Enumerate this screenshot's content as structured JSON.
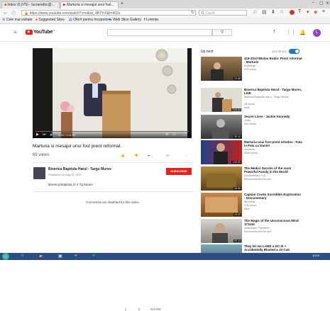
{
  "browser": {
    "tabs": [
      {
        "label": "Inbox (6,075) - lucraredoc@..."
      },
      {
        "label": "Marturia si mesajul unui fost..."
      }
    ],
    "new_tab": "+",
    "url": "https://www.youtube.com/watch?v=ulkss_4B7Yr0&t=402s",
    "search_placeholder": "Cautã",
    "bookmarks": [
      "Cele mai vizitate",
      "Suggested Sites",
      "Oferit pentru Inceputiori",
      "Web Slice Gallery",
      "Lorenta"
    ]
  },
  "youtube": {
    "logo": "YouTube",
    "logo_suffix": "RO",
    "avatar_letter": "L"
  },
  "video": {
    "time": "0:23 / 1:11:52",
    "title": "Marturia si mesajul unui fost preot reformat.",
    "views": "69 views",
    "likes": "1",
    "dislikes": "0",
    "share": "SHARE"
  },
  "channel": {
    "name": "Biserica Baptista Harul - Targu Mures",
    "published": "Published on Aug 22, 2017",
    "subscribe": "SUBSCRIBE",
    "description": "Biserica Baptista nr 2 Tg Mures"
  },
  "comments_text": "Comments are disabled for this video.",
  "sidebar": {
    "up_next": "Up next",
    "autoplay": "AUTOPLAY",
    "items": [
      {
        "title": "419-2013 Mislos Bodis- Preot reformat - Marturie",
        "channel": "bodisinge",
        "views": "276 views",
        "duration": "24:48"
      },
      {
        "title": "Biserica Baptista Harul - Targu Mures, LIVE",
        "channel": "Biserica Baptista Harul - Targu Mures",
        "views": "48 views",
        "extra": "New",
        "duration": "2:04:34"
      },
      {
        "title": "Secret Lives - Jackie Kennedy",
        "channel": "Jolan",
        "views": "615 views",
        "duration": "50:10"
      },
      {
        "title": "Marturia unui fost preot ortodox - Fata in Fata cu Daniel",
        "channel": "Videlinsu",
        "views": "3836 views",
        "duration": "1:00:00"
      },
      {
        "title": "The Medici Secrets of the most Powerful Family in the World",
        "channel": "Documentary Fu3",
        "views": "Recommended for you",
        "duration": "46:58"
      },
      {
        "title": "Captain Cooks Incredible Exploration - Documentary",
        "channel": "Worldlink",
        "views": "276 views",
        "extra": "New",
        "duration": "43:32"
      },
      {
        "title": "The Magic of the Unconscious Mind 171144",
        "channel": "Avatrasism Travelers",
        "views": "Recommended for you",
        "duration": "52:13"
      },
      {
        "title": "They let me LAND a DC-3! + Accidentally Blasted a J3 Cub",
        "channel": "",
        "views": "",
        "duration": ""
      }
    ]
  },
  "taskbar": {
    "clock": "10:04"
  }
}
